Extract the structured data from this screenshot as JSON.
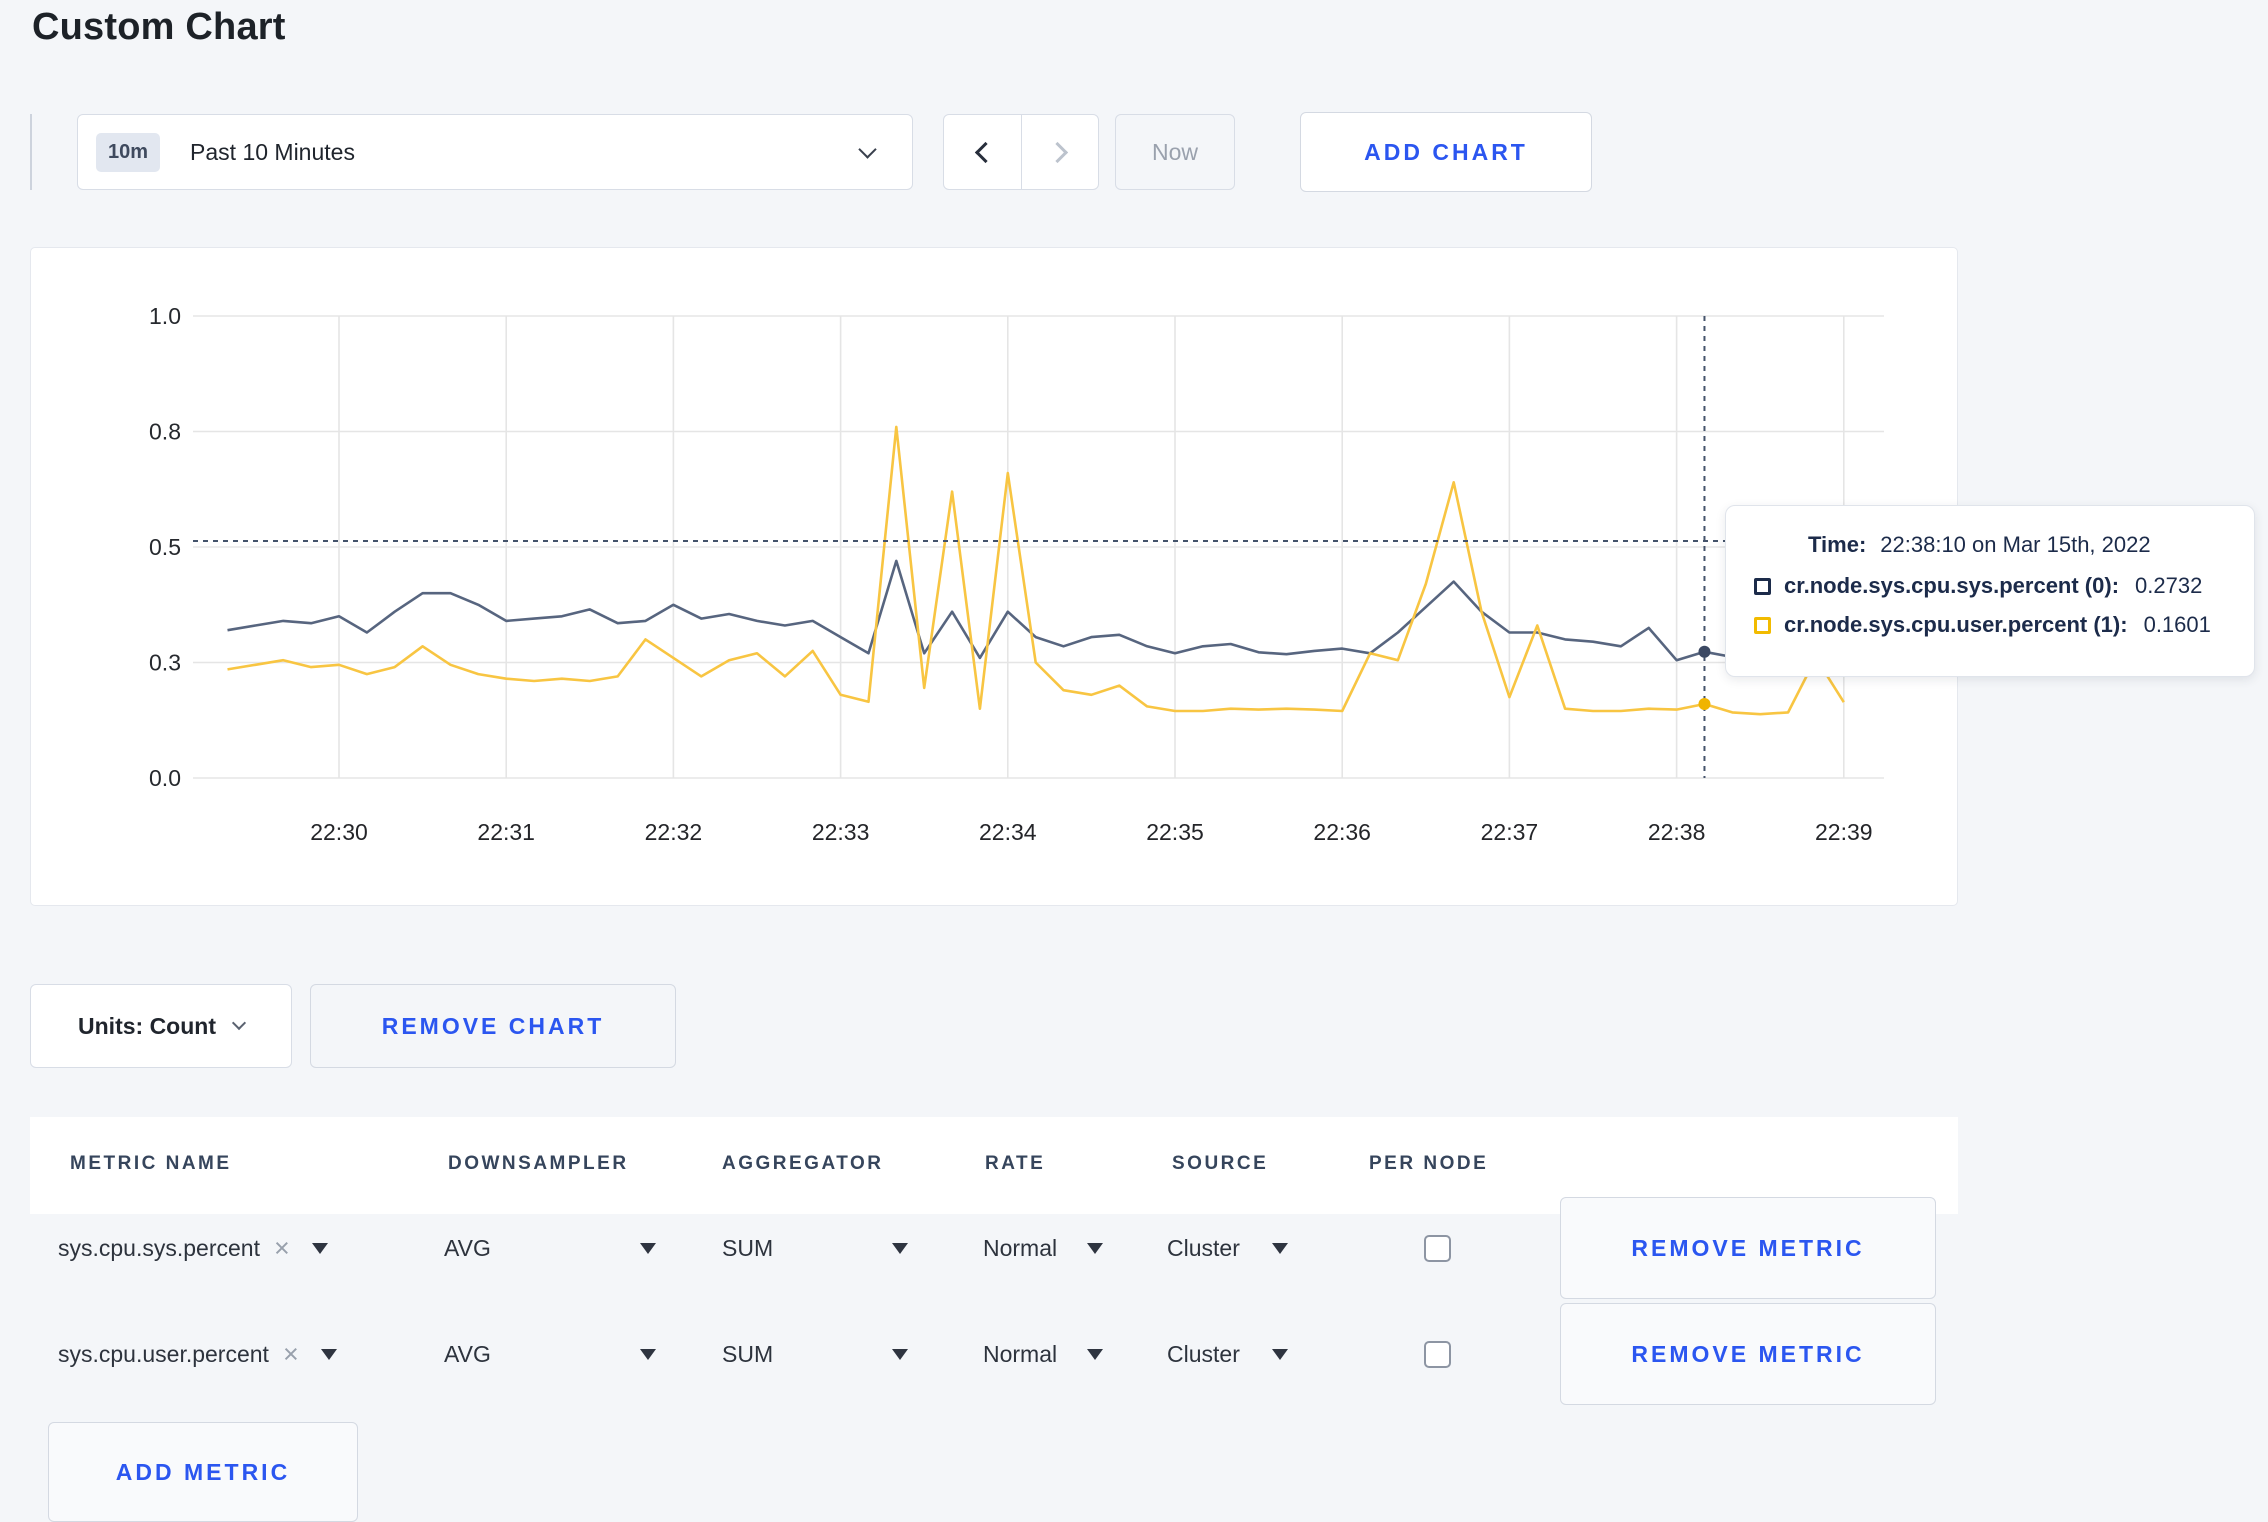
{
  "page": {
    "title": "Custom Chart",
    "background_color": "#f4f6f9",
    "accent_color": "#2b56f0"
  },
  "toolbar": {
    "time_window_badge": "10m",
    "time_window_label": "Past 10 Minutes",
    "now_label": "Now",
    "add_chart_label": "ADD CHART",
    "icons": [
      "chevron-down-icon",
      "chevron-left-icon",
      "chevron-right-icon"
    ]
  },
  "chart_data": {
    "type": "line",
    "title": "",
    "xlabel": "",
    "ylabel": "",
    "ylim": [
      0,
      1
    ],
    "grid": true,
    "legend_position": "none",
    "y_ticks": [
      {
        "value": 0.0,
        "label": "0.0"
      },
      {
        "value": 0.25,
        "label": "0.3"
      },
      {
        "value": 0.5,
        "label": "0.5"
      },
      {
        "value": 0.75,
        "label": "0.8"
      },
      {
        "value": 1.0,
        "label": "1.0"
      }
    ],
    "x_ticks": [
      "22:30",
      "22:31",
      "22:32",
      "22:33",
      "22:34",
      "22:35",
      "22:36",
      "22:37",
      "22:38",
      "22:39"
    ],
    "start_time": "22:29:20",
    "interval_seconds": 10,
    "series": [
      {
        "name": "cr.node.sys.cpu.sys.percent",
        "color": "#57657f",
        "dot_color": "#3c4963",
        "values": [
          0.32,
          0.33,
          0.34,
          0.335,
          0.35,
          0.315,
          0.36,
          0.4,
          0.4,
          0.375,
          0.34,
          0.345,
          0.35,
          0.365,
          0.335,
          0.34,
          0.375,
          0.345,
          0.355,
          0.34,
          0.33,
          0.34,
          0.305,
          0.27,
          0.47,
          0.27,
          0.36,
          0.26,
          0.36,
          0.305,
          0.285,
          0.305,
          0.31,
          0.285,
          0.27,
          0.285,
          0.29,
          0.272,
          0.268,
          0.275,
          0.28,
          0.27,
          0.315,
          0.37,
          0.425,
          0.36,
          0.315,
          0.315,
          0.3,
          0.295,
          0.285,
          0.325,
          0.255,
          0.2732,
          0.262,
          0.27,
          0.28,
          0.272,
          0.268
        ]
      },
      {
        "name": "cr.node.sys.cpu.user.percent",
        "color": "#f8c542",
        "dot_color": "#f0b400",
        "values": [
          0.235,
          0.245,
          0.255,
          0.24,
          0.245,
          0.225,
          0.24,
          0.285,
          0.245,
          0.225,
          0.215,
          0.21,
          0.215,
          0.21,
          0.22,
          0.3,
          0.26,
          0.22,
          0.255,
          0.27,
          0.22,
          0.275,
          0.18,
          0.165,
          0.76,
          0.195,
          0.62,
          0.15,
          0.66,
          0.25,
          0.19,
          0.18,
          0.2,
          0.155,
          0.145,
          0.145,
          0.15,
          0.148,
          0.15,
          0.148,
          0.145,
          0.27,
          0.255,
          0.42,
          0.64,
          0.36,
          0.175,
          0.33,
          0.15,
          0.145,
          0.145,
          0.15,
          0.148,
          0.1601,
          0.142,
          0.138,
          0.142,
          0.26,
          0.164
        ]
      }
    ],
    "crosshair": {
      "time": "22:38:10",
      "hline_value": 0.513
    }
  },
  "tooltip": {
    "time_label": "Time:",
    "time_value": "22:38:10 on Mar 15th, 2022",
    "rows": [
      {
        "name": "cr.node.sys.cpu.sys.percent (0):",
        "value": "0.2732",
        "color": "#1c2b4a"
      },
      {
        "name": "cr.node.sys.cpu.user.percent (1):",
        "value": "0.1601",
        "color": "#f2bb00"
      }
    ]
  },
  "units_bar": {
    "units_label": "Units: Count",
    "remove_chart_label": "REMOVE CHART"
  },
  "metrics_table": {
    "columns": [
      "METRIC NAME",
      "DOWNSAMPLER",
      "AGGREGATOR",
      "RATE",
      "SOURCE",
      "PER NODE"
    ],
    "rows": [
      {
        "metric": "sys.cpu.sys.percent",
        "downsampler": "AVG",
        "aggregator": "SUM",
        "rate": "Normal",
        "source": "Cluster",
        "per_node_checked": false,
        "remove_label": "REMOVE METRIC"
      },
      {
        "metric": "sys.cpu.user.percent",
        "downsampler": "AVG",
        "aggregator": "SUM",
        "rate": "Normal",
        "source": "Cluster",
        "per_node_checked": false,
        "remove_label": "REMOVE METRIC"
      }
    ],
    "add_metric_label": "ADD METRIC"
  }
}
